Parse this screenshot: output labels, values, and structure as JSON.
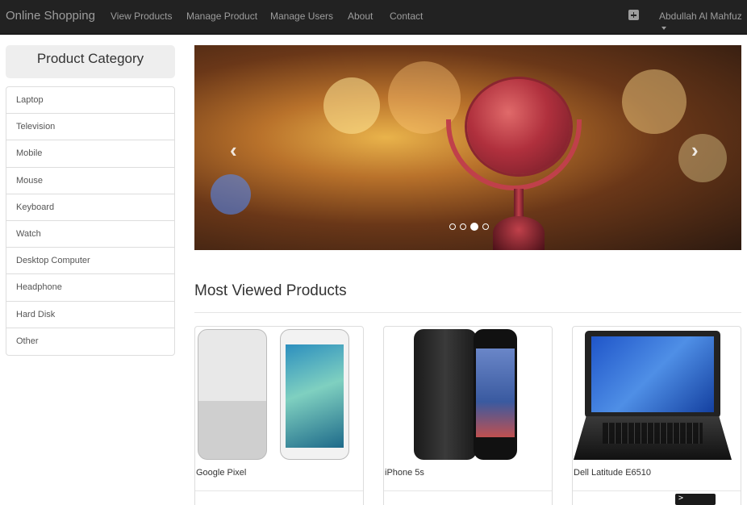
{
  "navbar": {
    "brand": "Online Shopping",
    "links": [
      "View Products",
      "Manage Product",
      "Manage Users",
      "About",
      "Contact"
    ],
    "cart_icon": "plus-square-icon",
    "user_name": "Abdullah Al Mahfuz"
  },
  "sidebar": {
    "title": "Product Category",
    "categories": [
      "Laptop",
      "Television",
      "Mobile",
      "Mouse",
      "Keyboard",
      "Watch",
      "Desktop Computer",
      "Headphone",
      "Hard Disk",
      "Other"
    ]
  },
  "carousel": {
    "prev_icon": "‹",
    "next_icon": "›",
    "slide_count": 4,
    "active_slide": 3
  },
  "main": {
    "section_title": "Most Viewed Products",
    "products": [
      {
        "name": "Google Pixel"
      },
      {
        "name": "iPhone 5s"
      },
      {
        "name": "Dell Latitude E6510"
      }
    ]
  },
  "terminal_prompt": ">"
}
